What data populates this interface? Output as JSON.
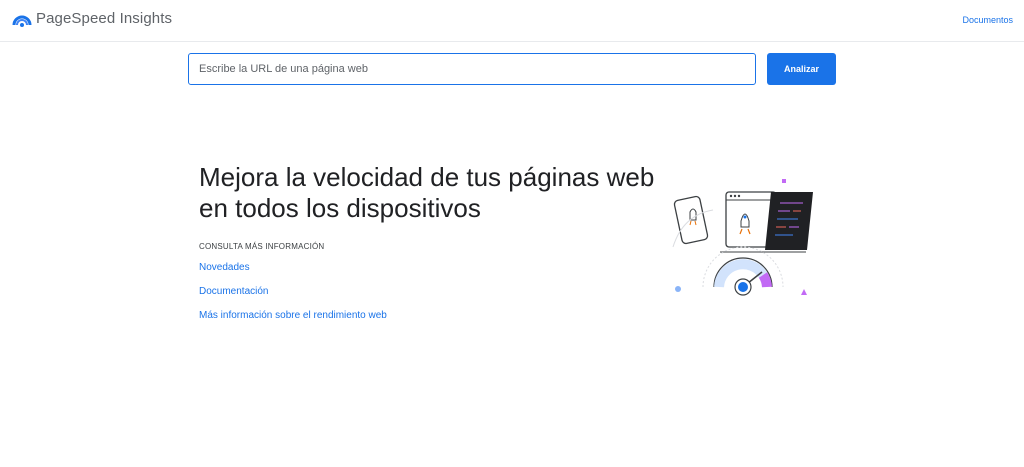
{
  "header": {
    "app_title": "PageSpeed Insights",
    "logo_icon": "pagespeed-gauge-icon",
    "docs_link": "Documentos"
  },
  "search": {
    "placeholder": "Escribe la URL de una página web",
    "value": "",
    "analyze_label": "Analizar"
  },
  "main": {
    "headline_line1": "Mejora la velocidad de tus páginas web",
    "headline_line2": "en todos los dispositivos",
    "more_info_label": "CONSULTA MÁS INFORMACIÓN",
    "links": [
      "Novedades",
      "Documentación",
      "Más información sobre el rendimiento web"
    ],
    "illustration_icon": "devices-speed-gauge-illustration"
  },
  "colors": {
    "accent": "#1a73e8",
    "text": "#202124",
    "secondary_text": "#5f6368",
    "divider": "#e8eaed"
  }
}
